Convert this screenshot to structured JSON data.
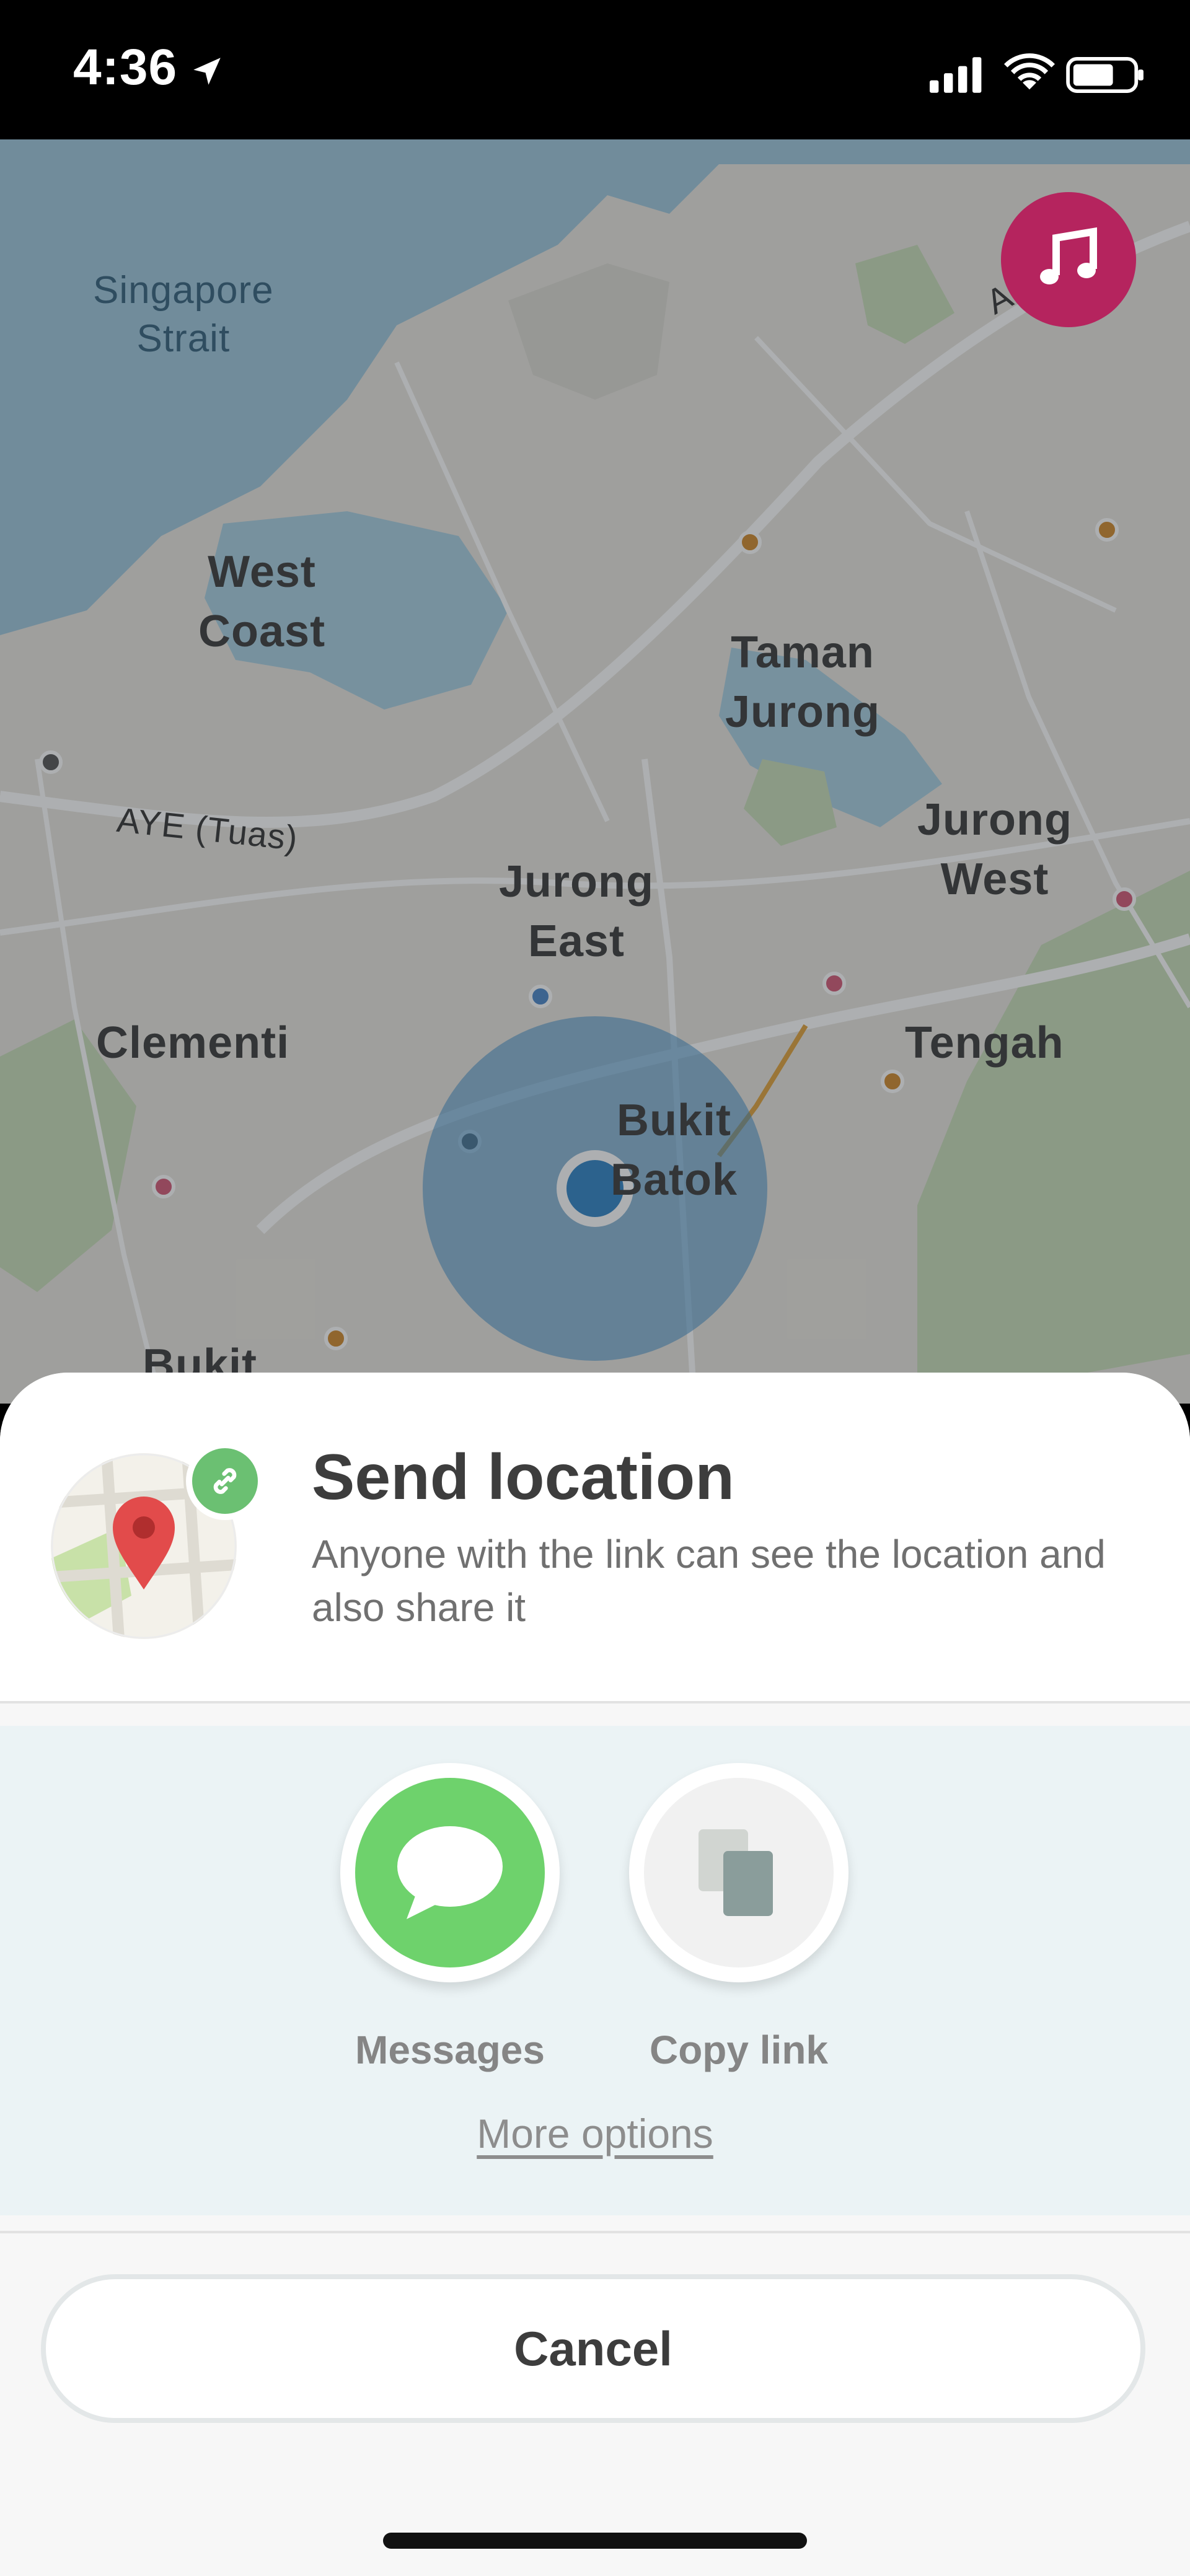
{
  "status_bar": {
    "time": "4:36",
    "icons": [
      "location-arrow-icon",
      "cellular-signal-icon",
      "wifi-icon",
      "battery-icon"
    ]
  },
  "map": {
    "labels": {
      "singapore_strait": "Singapore\nStrait",
      "west_coast": "West\nCoast",
      "taman_jurong": "Taman\nJurong",
      "jurong_west": "Jurong\nWest",
      "jurong_east": "Jurong\nEast",
      "clementi": "Clementi",
      "tengah": "Tengah",
      "bukit_batok": "Bukit\nBatok",
      "bukit_partial": "Bukit",
      "aye_road": "AYE (Tuas)",
      "expressway_partial": "A          y)"
    },
    "music_button_icon": "music-note-icon"
  },
  "sheet": {
    "title": "Send location",
    "subtitle": "Anyone with the link can see the location and also share it",
    "share_options": [
      {
        "label": "Messages",
        "icon": "speech-bubble-icon",
        "color": "#6ed26c"
      },
      {
        "label": "Copy link",
        "icon": "copy-icon",
        "color": "#f1f1f1"
      }
    ],
    "more_options": "More options",
    "cancel": "Cancel"
  },
  "colors": {
    "sheet_background": "#ffffff",
    "share_panel": "#ebf3f5",
    "music_button": "#b5245e",
    "link_badge": "#6bc072",
    "location_dot": "#2f83c5"
  }
}
